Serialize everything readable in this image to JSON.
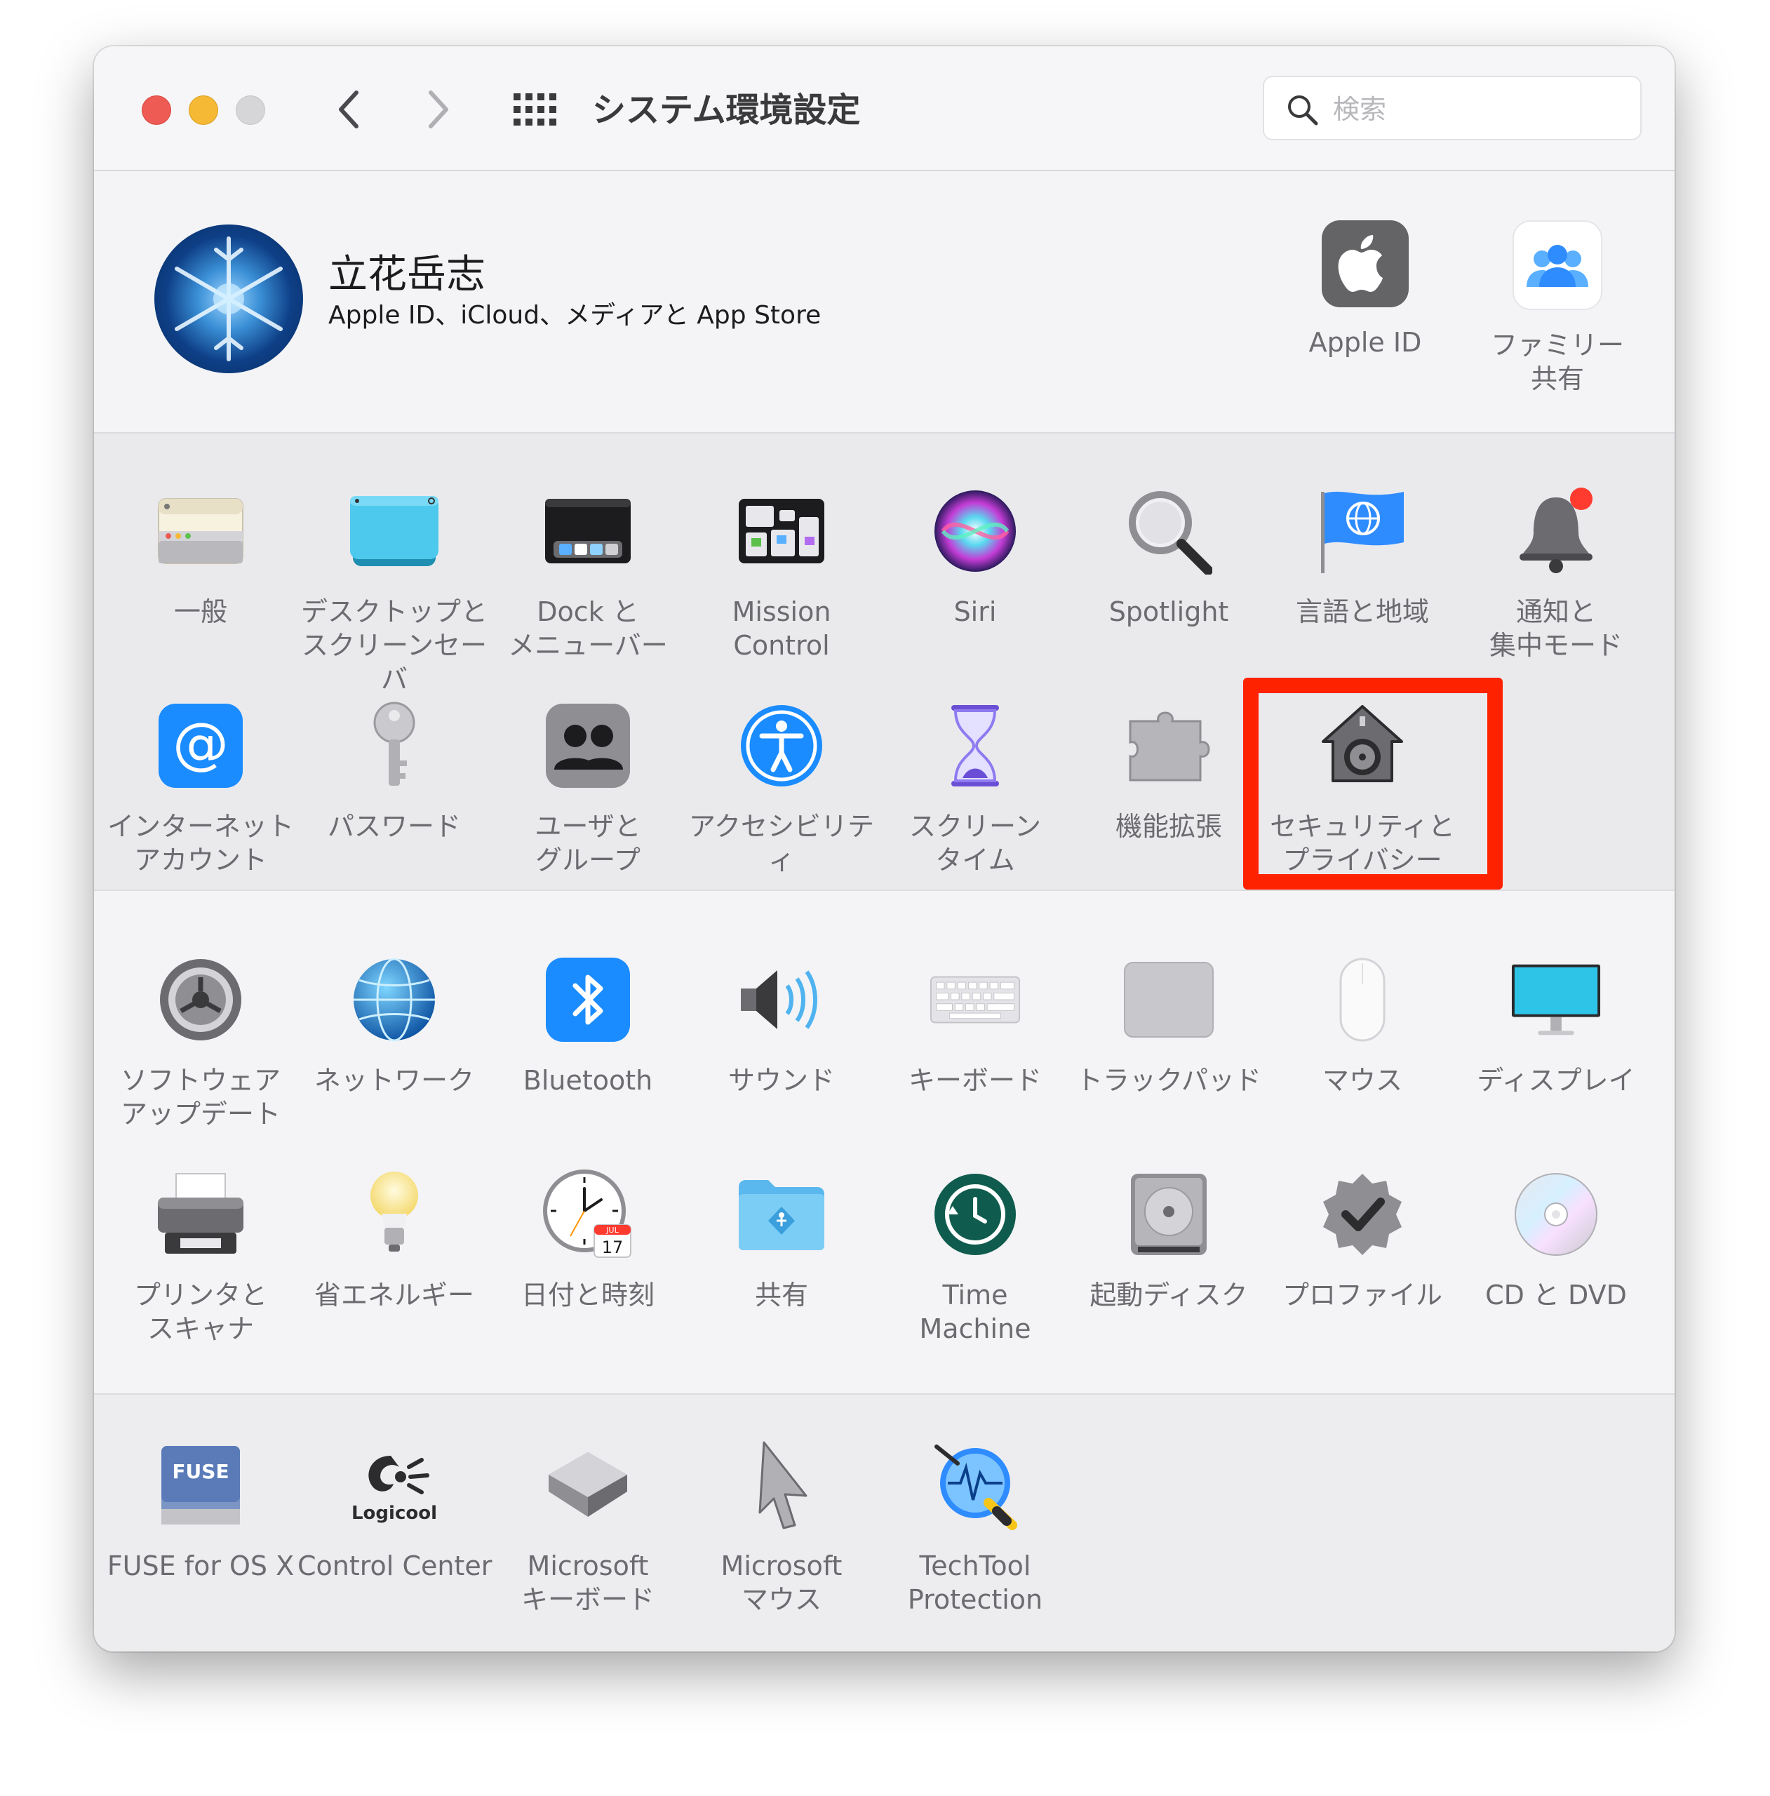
{
  "window": {
    "title": "システム環境設定",
    "search_placeholder": "検索"
  },
  "account": {
    "name": "立花岳志",
    "subtitle": "Apple ID、iCloud、メディアと App Store",
    "apple_id_label": "Apple ID",
    "family_label": "ファミリー\n共有"
  },
  "sections": {
    "personal": [
      "一般",
      "デスクトップと\nスクリーンセーバ",
      "Dock と\nメニューバー",
      "Mission\nControl",
      "Siri",
      "Spotlight",
      "言語と地域",
      "通知と\n集中モード",
      "インターネット\nアカウント",
      "パスワード",
      "ユーザと\nグループ",
      "アクセシビリティ",
      "スクリーン\nタイム",
      "機能拡張",
      "セキュリティと\nプライバシー"
    ],
    "hardware": [
      "ソフトウェア\nアップデート",
      "ネットワーク",
      "Bluetooth",
      "サウンド",
      "キーボード",
      "トラックパッド",
      "マウス",
      "ディスプレイ",
      "プリンタと\nスキャナ",
      "省エネルギー",
      "日付と時刻",
      "共有",
      "Time\nMachine",
      "起動ディスク",
      "プロファイル",
      "CD と DVD"
    ],
    "other": [
      "FUSE for OS X",
      "Control Center",
      "Microsoft\nキーボード",
      "Microsoft\nマウス",
      "TechTool\nProtection"
    ]
  },
  "icons": {
    "fuse_text": "FUSE",
    "logicool_text": "Logicool",
    "calendar_month": "JUL",
    "calendar_day": "17"
  },
  "colors": {
    "highlight": "#ff2200",
    "accent_blue": "#1a8cff"
  }
}
